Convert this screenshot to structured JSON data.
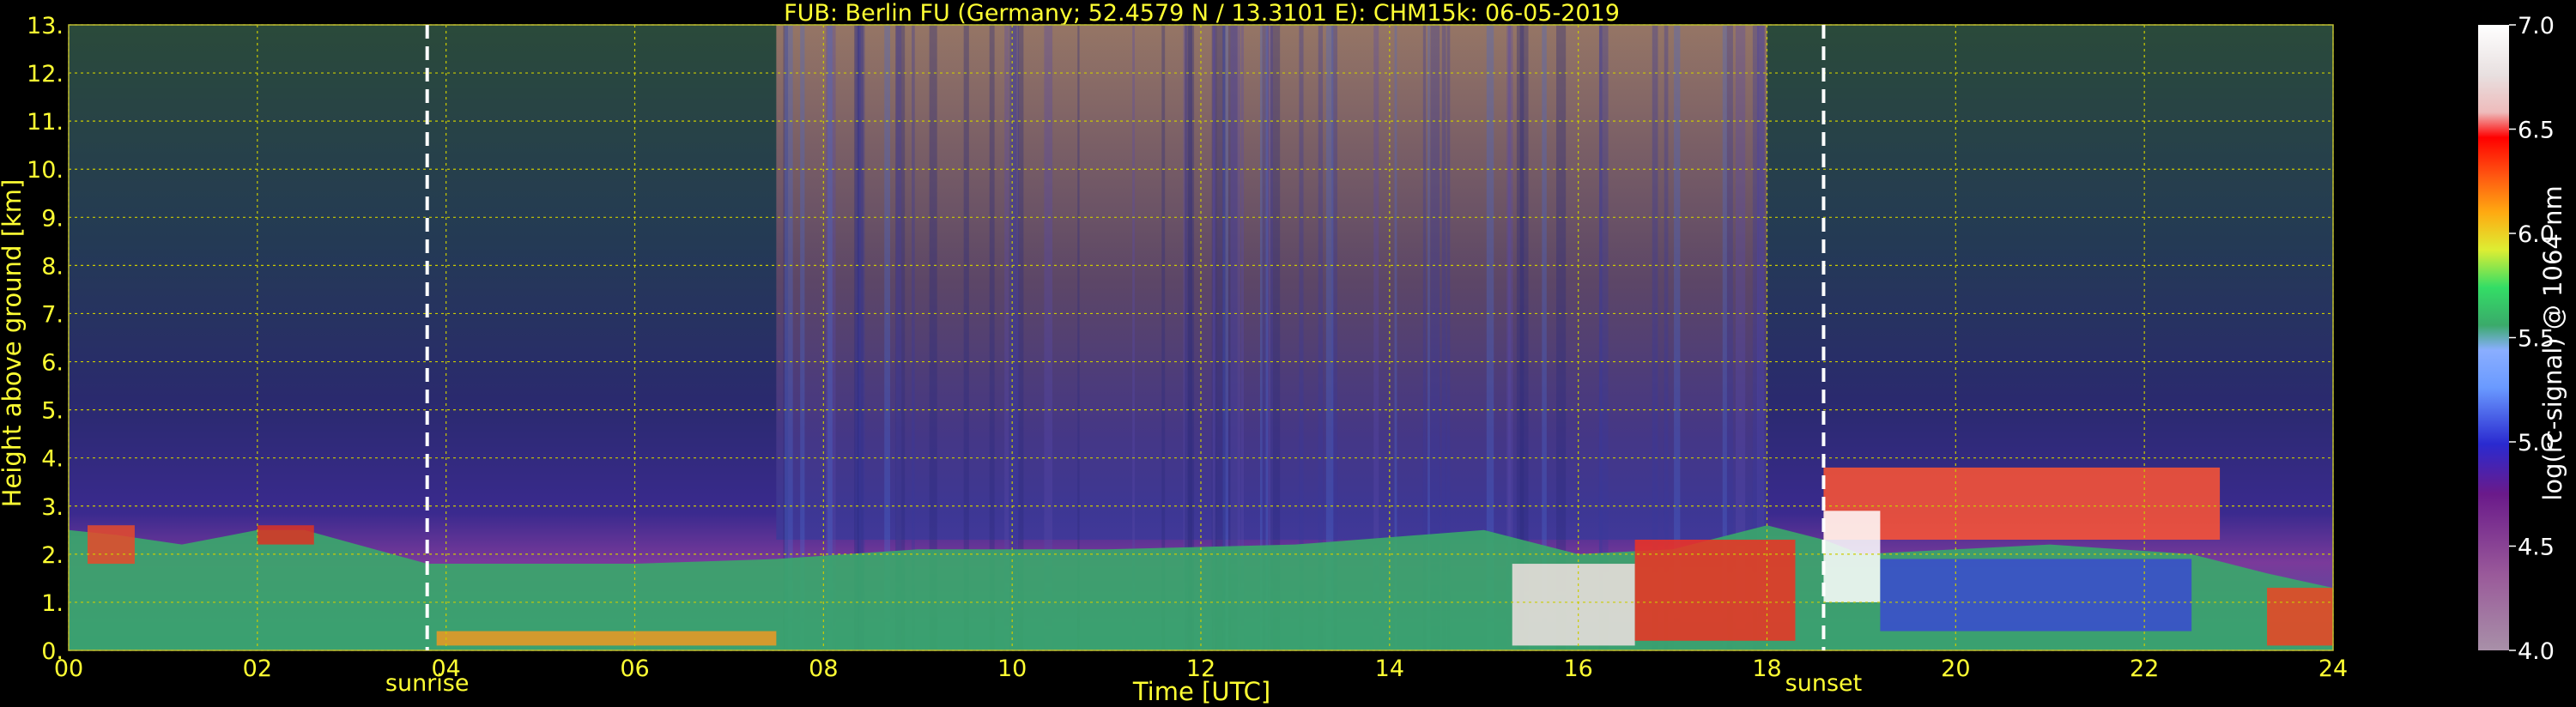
{
  "chart_data": {
    "type": "heatmap",
    "title": "FUB: Berlin FU (Germany; 52.4579 N / 13.3101 E):    CHM15k: 06-05-2019",
    "xlabel": "Time [UTC]",
    "ylabel": "Height above ground [km]",
    "xlim": [
      0,
      24
    ],
    "ylim": [
      0,
      13
    ],
    "x_ticks": [
      0,
      2,
      4,
      6,
      8,
      10,
      12,
      14,
      16,
      18,
      20,
      22,
      24
    ],
    "x_tick_labels": [
      "00",
      "02",
      "04",
      "06",
      "08",
      "10",
      "12",
      "14",
      "16",
      "18",
      "20",
      "22",
      "24"
    ],
    "y_ticks": [
      0,
      1,
      2,
      3,
      4,
      5,
      6,
      7,
      8,
      9,
      10,
      11,
      12,
      13
    ],
    "y_tick_labels": [
      "0.",
      "1.",
      "2.",
      "3.",
      "4.",
      "5.",
      "6.",
      "7.",
      "8.",
      "9.",
      "10.",
      "11.",
      "12.",
      "13."
    ],
    "grid": true,
    "colorbar": {
      "label": "log(rc-signal) @ 1064 nm",
      "range": [
        4.0,
        7.0
      ],
      "ticks": [
        4.0,
        4.5,
        5.0,
        5.5,
        6.0,
        6.5,
        7.0
      ],
      "tick_labels": [
        "4.0",
        "4.5",
        "5.0",
        "5.5",
        "6.0",
        "6.5",
        "7.0"
      ]
    },
    "markers": [
      {
        "label": "sunrise",
        "x": 3.8
      },
      {
        "label": "sunset",
        "x": 18.6
      }
    ],
    "colors": {
      "text": "#ffff33",
      "grid": "#cccc00",
      "marker_line": "#ffffff"
    }
  }
}
